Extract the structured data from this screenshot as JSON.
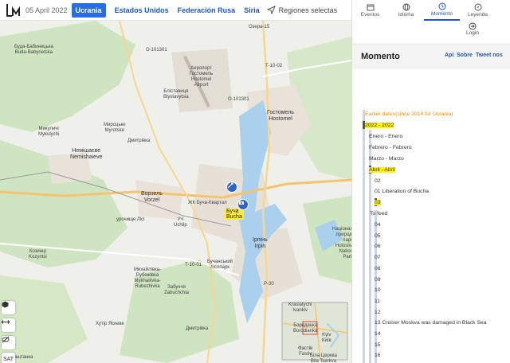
{
  "topbar": {
    "date": "05 April 2022",
    "nav": [
      "Ucrania",
      "Estados Unidos",
      "Federación Rusa",
      "Siria"
    ],
    "region_label": "Regiones selectas"
  },
  "panel": {
    "tabs": [
      {
        "label": "Eventos",
        "icon": "events-icon"
      },
      {
        "label": "Idioma",
        "icon": "globe-icon"
      },
      {
        "label": "Momento",
        "icon": "clock-icon"
      },
      {
        "label": "Leyenda",
        "icon": "compass-icon"
      }
    ],
    "login_label": "Login",
    "title": "Momento",
    "links": [
      "Api",
      "Sobre",
      "Tweet nos"
    ]
  },
  "timeline": {
    "earlier": "Earlier dates(since 2014 for Ucrania)",
    "year": "2022 - 2022",
    "months": [
      "Enero - Enero",
      "Febrero - Febrero",
      "Marzo - Marzo",
      "Abril - Abril"
    ],
    "days": [
      "02",
      "01 Liberation of Bucha",
      "03",
      "To feed",
      "04",
      "05",
      "06",
      "07",
      "08",
      "09",
      "10",
      "11",
      "12",
      "13 Cruiser Moskva was damaged in Black Sea",
      "14",
      "15",
      "16"
    ]
  },
  "map": {
    "labels": [
      "Буда-Бабинецька\nBuda-Babynetska",
      "Озера-15",
      "О-101301",
      "Т-10-02",
      "Аеропорт\nГостомель\nHostomel\nAirport",
      "Бліставиця\nBlystavytsia",
      "О-101301",
      "Гостомель\nHostomel",
      "Микуличі\nMykulychi",
      "Мироцьке\nMyrotske",
      "Дмитрівка",
      "Немішаєве\nNemishaieve",
      "Ворзель\nVorzel",
      "ЖК Буча-Квартал",
      "Буча\nBucha",
      "урочище Лісі",
      "УЧ\nUchilp",
      "Ірпінь\nIrpin",
      "Козинці\nKozyntsi",
      "Бучанський\nлісопарк",
      "Національний\nприродний\nпарк\nHolosiivskyi\nNational\nPark",
      "Михайлівка-\nРубежівка\nMykhailivka-\nRubezhivka",
      "Забуччя\nZabuchchia",
      "Хутір Яскеве",
      "Дмитрівка",
      "Т-10-01",
      "Р-30",
      "Krasiatychi\nIvankiv",
      "Бородянка\nBorodianka",
      "Kyiv\nКиїв",
      "Фастів\nFastiv",
      "Біла Церква\nBila Tserkva",
      "Баштанка"
    ],
    "tools": [
      "hexagon-icon",
      "arrows-icon",
      "no-eye-icon",
      "SAT"
    ]
  }
}
